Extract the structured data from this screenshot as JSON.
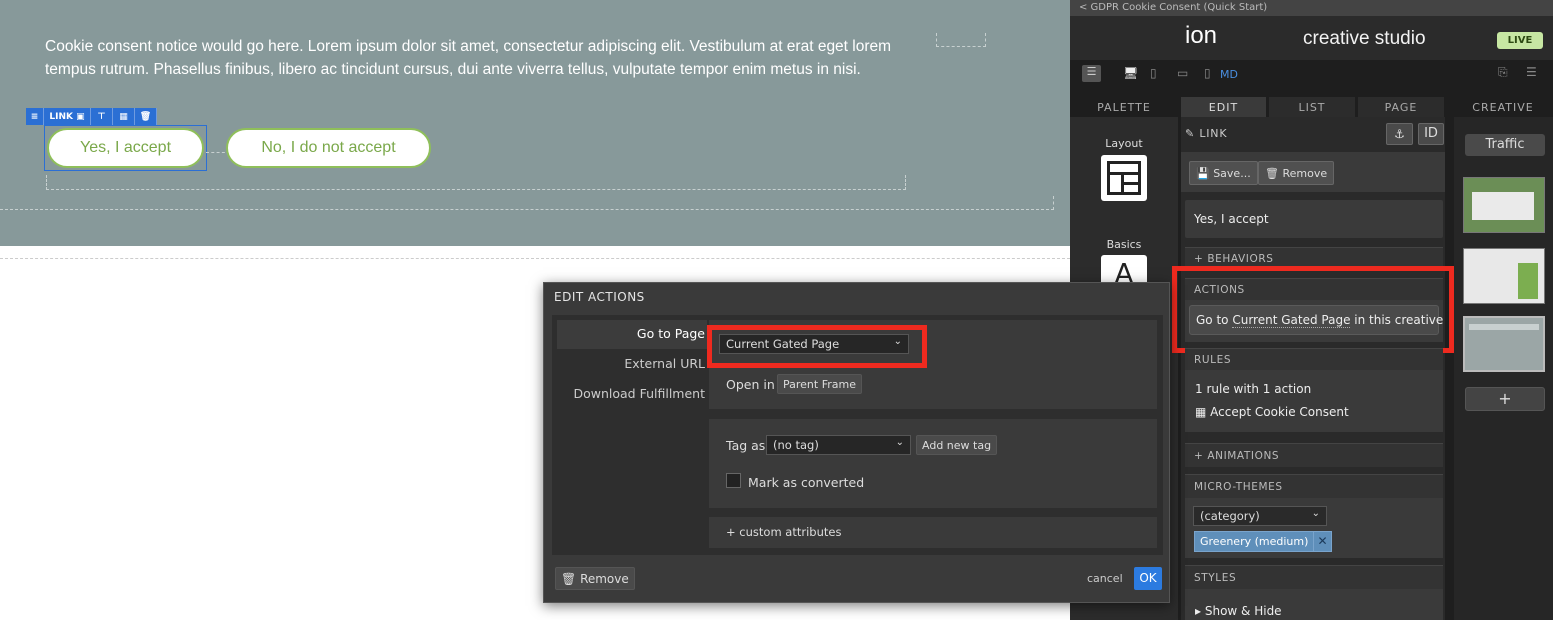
{
  "canvas": {
    "banner_text": "Cookie consent notice would go here. Lorem ipsum dolor sit amet, consectetur adipiscing elit. Vestibulum at erat eget lorem tempus rutrum. Phasellus finibus, libero ac tincidunt cursus, dui ante viverra tellus, vulputate tempor enim metus in nisi.",
    "toolbar_label": "LINK",
    "accept_label": "Yes, I accept",
    "decline_label": "No, I do not accept",
    "brand_color": "#87999a",
    "button_color": "#8fbf5a"
  },
  "dialog": {
    "title": "EDIT ACTIONS",
    "options": [
      "Go to Page",
      "External URL",
      "Download Fulfillment"
    ],
    "page_select": "Current Gated Page",
    "open_in_label": "Open in",
    "open_in_value": "Parent Frame",
    "tag_as_label": "Tag as",
    "tag_select": "(no tag)",
    "add_tag_label": "Add new tag",
    "mark_converted_label": "Mark as converted",
    "custom_attributes": "+ custom attributes",
    "remove_label": "Remove",
    "cancel_label": "cancel",
    "ok_label": "OK",
    "highlight_color": "#ee2a1f"
  },
  "studio": {
    "breadcrumb": "< GDPR Cookie Consent (Quick Start)",
    "logo": "ion",
    "product": "creative studio",
    "live_badge": "LIVE",
    "size_label": "MD",
    "tabs": [
      "PALETTE",
      "EDIT",
      "LIST",
      "PAGE",
      "CREATIVE"
    ],
    "palette": [
      "Layout",
      "Basics"
    ],
    "edit": {
      "element_label": "LINK",
      "id_label": "ID",
      "save_label": "Save...",
      "remove_label": "Remove",
      "link_text": "Yes, I accept",
      "behaviors": "+ BEHAVIORS",
      "actions_head": "ACTIONS",
      "action_prefix": "Go to",
      "action_target": "Current Gated Page",
      "action_suffix": "in this creative",
      "rules_head": "RULES",
      "rules_summary": "1 rule with 1 action",
      "rule_name": "Accept Cookie Consent",
      "animations": "+ ANIMATIONS",
      "micro_head": "MICRO-THEMES",
      "category_select": "(category)",
      "theme_tag": "Greenery (medium)",
      "styles_head": "STYLES",
      "show_hide": "Show & Hide"
    },
    "creative": {
      "traffic_label": "Traffic",
      "add_label": "+"
    }
  }
}
